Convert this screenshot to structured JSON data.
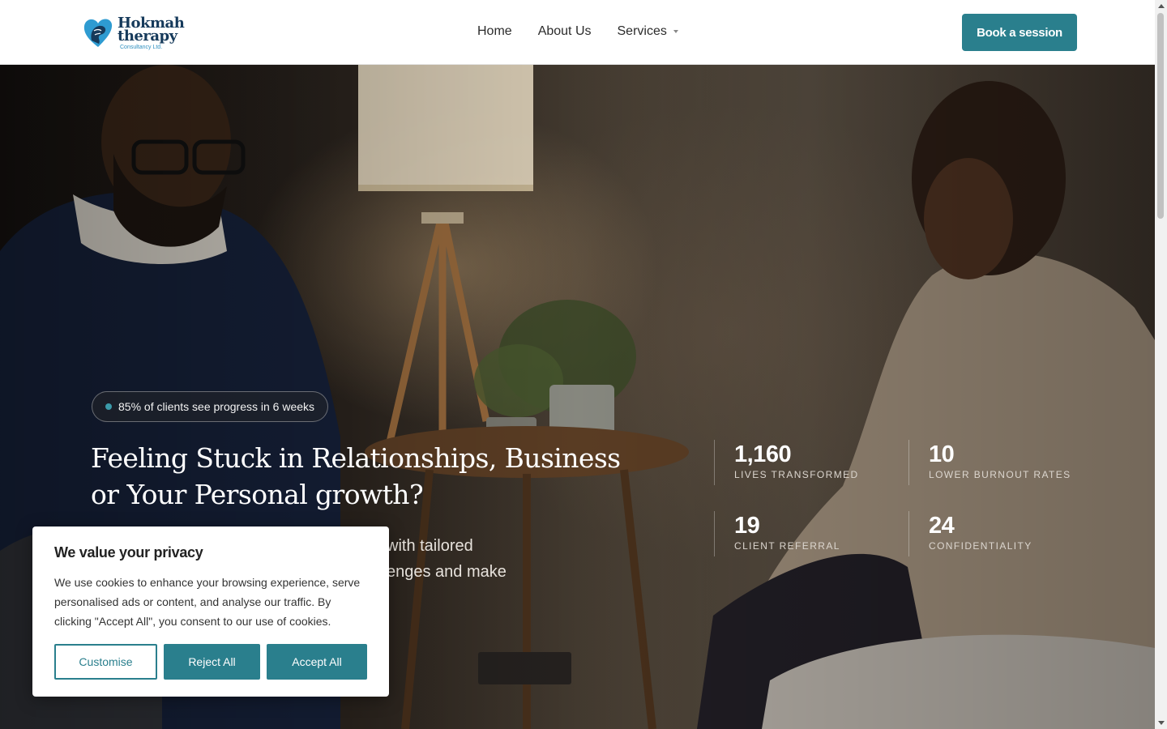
{
  "brand": {
    "line1": "Hokmah",
    "line2": "therapy",
    "line3": "Consultancy Ltd.",
    "primary_color": "#2a7f8d",
    "navy_color": "#163a5b",
    "logo_icon": "heart-brain-logo-icon"
  },
  "nav": {
    "items": [
      {
        "label": "Home"
      },
      {
        "label": "About Us"
      },
      {
        "label": "Services",
        "has_dropdown": true
      }
    ],
    "cta_label": "Book a session"
  },
  "hero": {
    "badge": "85% of clients see progress in 6 weeks",
    "headline": "Feeling Stuck in Relationships, Business or Your Personal growth?",
    "subtext_visible": "with tailored\nenges and make",
    "stats": [
      {
        "value": "1,160",
        "label": "LIVES TRANSFORMED"
      },
      {
        "value": "10",
        "label": "LOWER BURNOUT RATES"
      },
      {
        "value": "19",
        "label": "CLIENT REFERRAL"
      },
      {
        "value": "24",
        "label": "CONFIDENTIALITY"
      }
    ]
  },
  "cookie_banner": {
    "title": "We value your privacy",
    "body": "We use cookies to enhance your browsing experience, serve personalised ads or content, and analyse our traffic. By clicking \"Accept All\", you consent to our use of cookies.",
    "customise_label": "Customise",
    "reject_label": "Reject All",
    "accept_label": "Accept All"
  }
}
